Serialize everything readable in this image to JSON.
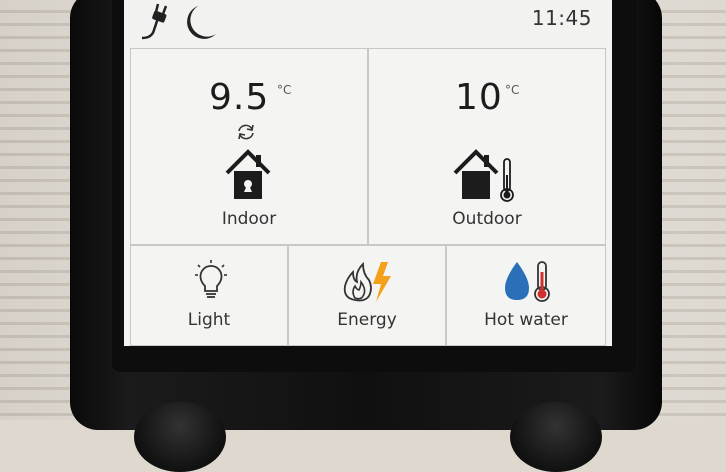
{
  "status_bar": {
    "mode_icon": "night-mode-icon",
    "time": "11:45"
  },
  "indoor": {
    "value": "9.5",
    "unit": "°C",
    "label": "Indoor",
    "icons": [
      "sync-icon",
      "house-icon"
    ]
  },
  "outdoor": {
    "value": "10",
    "unit": "°C",
    "label": "Outdoor",
    "icons": [
      "house-icon",
      "thermometer-icon"
    ]
  },
  "tiles": [
    {
      "label": "Light",
      "icon": "lightbulb-icon"
    },
    {
      "label": "Energy",
      "icon": "energy-icon"
    },
    {
      "label": "Hot water",
      "icon": "hot-water-icon"
    }
  ],
  "colors": {
    "screen_bg": "#f2f3f1",
    "energy_bolt": "#f5a01a",
    "water_drop": "#2a6fb8",
    "thermometer_red": "#d0312d"
  }
}
